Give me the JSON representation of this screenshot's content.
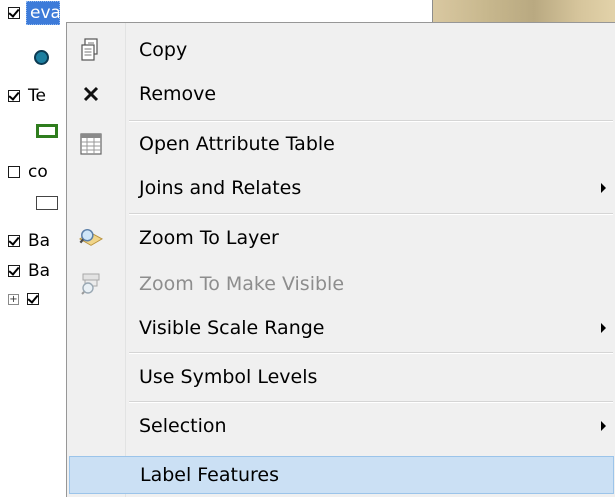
{
  "toc": {
    "layers": [
      {
        "label": "evan",
        "checked": true,
        "selected": true
      },
      {
        "label": "Te",
        "checked": true
      },
      {
        "label": "co",
        "checked": false
      },
      {
        "label": "Ba",
        "checked": true
      },
      {
        "label": "Ba",
        "checked": true
      }
    ],
    "expander": "+"
  },
  "menu": {
    "items": [
      {
        "label": "Copy",
        "icon": "copy-icon"
      },
      {
        "label": "Remove",
        "icon": "remove-icon"
      },
      {
        "label": "Open Attribute Table",
        "icon": "table-icon"
      },
      {
        "label": "Joins and Relates",
        "submenu": true
      },
      {
        "label": "Zoom To Layer",
        "icon": "zoom-to-layer-icon"
      },
      {
        "label": "Zoom To Make Visible",
        "icon": "zoom-visible-icon",
        "disabled": true
      },
      {
        "label": "Visible Scale Range",
        "submenu": true
      },
      {
        "label": "Use Symbol Levels"
      },
      {
        "label": "Selection",
        "submenu": true
      },
      {
        "label": "Label Features",
        "highlighted": true
      }
    ]
  },
  "colors": {
    "menu_bg": "#f0f0f0",
    "highlight": "#cbe0f4",
    "selection": "#3d7bd9",
    "disabled_text": "#8d8d8d"
  }
}
